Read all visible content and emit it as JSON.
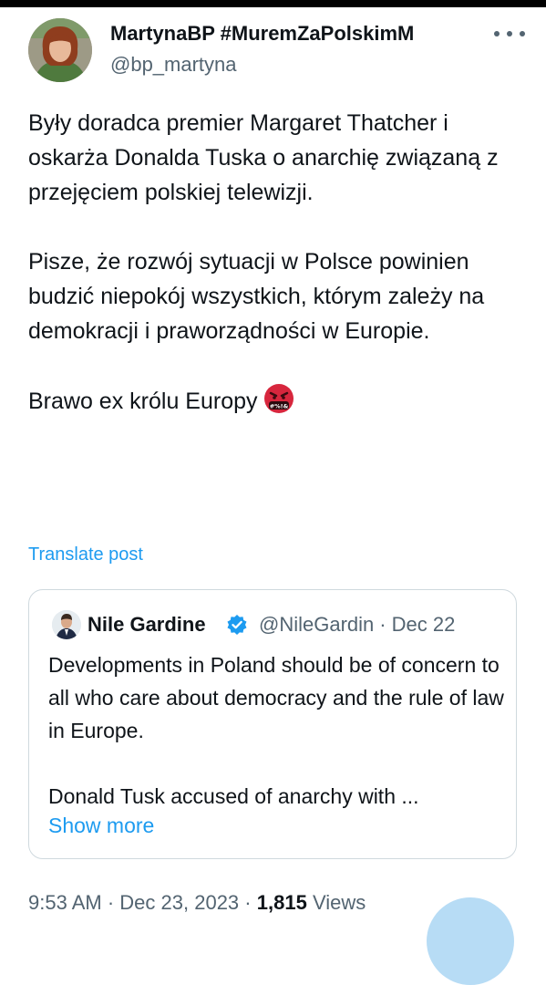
{
  "author": {
    "display_name": "MartynaBP #MuremZaPolskimM",
    "handle": "@bp_martyna",
    "avatar_icon": "profile-photo-woman"
  },
  "tweet": {
    "paragraphs": [
      "Były doradca premier Margaret Thatcher i oskarża Donalda Tuska o anarchię związaną z przejęciem polskiej telewizji.",
      "Pisze, że rozwój sytuacji w Polsce powinien budzić niepokój wszystkich, którym zależy na demokracji i praworządności w Europie.",
      "Brawo ex królu Europy"
    ],
    "emoji": "angry-face-with-symbols-icon",
    "emoji_text": "#%!&",
    "translate_label": "Translate post"
  },
  "quote": {
    "display_name": "Nile Gardine",
    "handle": "@NileGardin",
    "separator": "·",
    "date": "Dec 22",
    "paragraphs": [
      "Developments in Poland should be of concern to all who care about democracy and the rule of law in Europe.",
      "Donald Tusk accused of anarchy with ..."
    ],
    "show_more_label": "Show more",
    "verified_icon": "verified-badge-icon"
  },
  "meta": {
    "time": "9:53 AM",
    "separator": "·",
    "date": "Dec 23, 2023",
    "views_count": "1,815",
    "views_label": "Views"
  },
  "colors": {
    "link": "#1d9bf0",
    "secondary_text": "#536471",
    "primary_text": "#0f1419",
    "border": "#cfd9de"
  }
}
